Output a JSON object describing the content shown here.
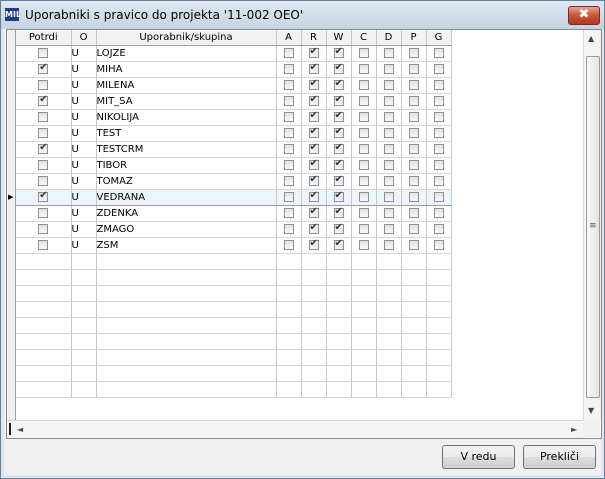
{
  "window": {
    "title": "Uporabniki s pravico do projekta '11-002 OEO'",
    "app_icon": "MIL",
    "close_symbol": "✖"
  },
  "grid": {
    "columns": [
      "Potrdi",
      "O",
      "Uporabnik/skupina",
      "A",
      "R",
      "W",
      "C",
      "D",
      "P",
      "G"
    ],
    "selected_row": "VEDRANA",
    "rows": [
      {
        "potrdi": false,
        "o": "U",
        "name": "LOJZE",
        "A": false,
        "R": true,
        "W": true,
        "C": false,
        "D": false,
        "P": false,
        "G": false
      },
      {
        "potrdi": true,
        "o": "U",
        "name": "MIHA",
        "A": false,
        "R": true,
        "W": true,
        "C": false,
        "D": false,
        "P": false,
        "G": false
      },
      {
        "potrdi": false,
        "o": "U",
        "name": "MILENA",
        "A": false,
        "R": true,
        "W": true,
        "C": false,
        "D": false,
        "P": false,
        "G": false
      },
      {
        "potrdi": true,
        "o": "U",
        "name": "MIT_SA",
        "A": false,
        "R": true,
        "W": true,
        "C": false,
        "D": false,
        "P": false,
        "G": false
      },
      {
        "potrdi": false,
        "o": "U",
        "name": "NIKOLIJA",
        "A": false,
        "R": true,
        "W": true,
        "C": false,
        "D": false,
        "P": false,
        "G": false
      },
      {
        "potrdi": false,
        "o": "U",
        "name": "TEST",
        "A": false,
        "R": true,
        "W": true,
        "C": false,
        "D": false,
        "P": false,
        "G": false
      },
      {
        "potrdi": true,
        "o": "U",
        "name": "TESTCRM",
        "A": false,
        "R": true,
        "W": true,
        "C": false,
        "D": false,
        "P": false,
        "G": false
      },
      {
        "potrdi": false,
        "o": "U",
        "name": "TIBOR",
        "A": false,
        "R": true,
        "W": true,
        "C": false,
        "D": false,
        "P": false,
        "G": false
      },
      {
        "potrdi": false,
        "o": "U",
        "name": "TOMAZ",
        "A": false,
        "R": true,
        "W": true,
        "C": false,
        "D": false,
        "P": false,
        "G": false
      },
      {
        "potrdi": true,
        "o": "U",
        "name": "VEDRANA",
        "A": false,
        "R": true,
        "W": true,
        "C": false,
        "D": false,
        "P": false,
        "G": false
      },
      {
        "potrdi": false,
        "o": "U",
        "name": "ZDENKA",
        "A": false,
        "R": true,
        "W": true,
        "C": false,
        "D": false,
        "P": false,
        "G": false
      },
      {
        "potrdi": false,
        "o": "U",
        "name": "ZMAGO",
        "A": false,
        "R": true,
        "W": true,
        "C": false,
        "D": false,
        "P": false,
        "G": false
      },
      {
        "potrdi": false,
        "o": "U",
        "name": "ZSM",
        "A": false,
        "R": true,
        "W": true,
        "C": false,
        "D": false,
        "P": false,
        "G": false
      }
    ],
    "empty_rows": 9
  },
  "scrollbars": {
    "vertical_grip": "≡",
    "up": "▲",
    "down": "▼",
    "left": "◄",
    "right": "►",
    "row_indicator": "▶"
  },
  "buttons": {
    "ok": "V redu",
    "cancel": "Prekliči"
  }
}
